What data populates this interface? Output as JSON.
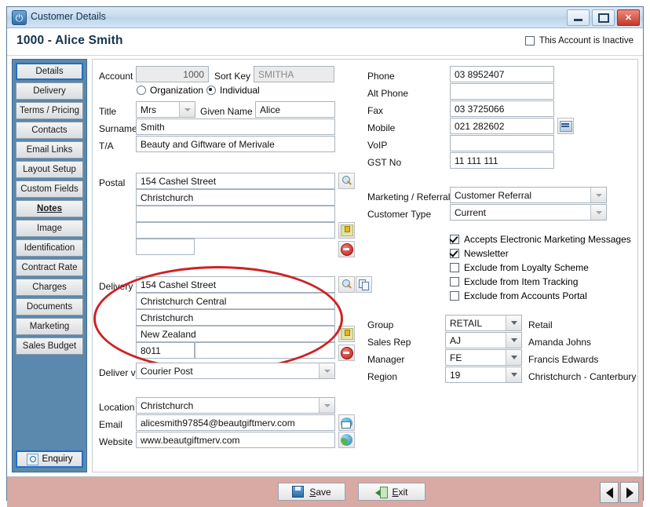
{
  "window": {
    "title": "Customer Details",
    "app_icon": "power-icon",
    "controls": {
      "minimize": "minimize-icon",
      "maximize": "maximize-icon",
      "close": "close-icon"
    }
  },
  "header": {
    "title": "1000 - Alice Smith",
    "inactive_label": "This Account is Inactive",
    "inactive_checked": false
  },
  "sidebar": {
    "items": [
      {
        "label": "Details",
        "selected": true,
        "emphasis": false
      },
      {
        "label": "Delivery",
        "selected": false,
        "emphasis": false
      },
      {
        "label": "Terms / Pricing",
        "selected": false,
        "emphasis": false
      },
      {
        "label": "Contacts",
        "selected": false,
        "emphasis": false
      },
      {
        "label": "Email Links",
        "selected": false,
        "emphasis": false
      },
      {
        "label": "Layout Setup",
        "selected": false,
        "emphasis": false
      },
      {
        "label": "Custom Fields",
        "selected": false,
        "emphasis": false
      },
      {
        "label": "Notes",
        "selected": false,
        "emphasis": true
      },
      {
        "label": "Image",
        "selected": false,
        "emphasis": false
      },
      {
        "label": "Identification",
        "selected": false,
        "emphasis": false
      },
      {
        "label": "Contract Rate",
        "selected": false,
        "emphasis": false
      },
      {
        "label": "Charges",
        "selected": false,
        "emphasis": false
      },
      {
        "label": "Documents",
        "selected": false,
        "emphasis": false
      },
      {
        "label": "Marketing",
        "selected": false,
        "emphasis": false
      },
      {
        "label": "Sales Budget",
        "selected": false,
        "emphasis": false
      }
    ],
    "enquiry_label": "Enquiry",
    "enquiry_icon": "enquiry-icon"
  },
  "form": {
    "account_label": "Account",
    "account_value": "1000",
    "sort_key_label": "Sort Key",
    "sort_key_value": "SMITHA",
    "entity_type": {
      "organization_label": "Organization",
      "individual_label": "Individual",
      "selected": "Individual"
    },
    "title_label": "Title",
    "title_value": "Mrs",
    "given_name_label": "Given Name",
    "given_name_value": "Alice",
    "surname_label": "Surname",
    "surname_value": "Smith",
    "ta_label": "T/A",
    "ta_value": "Beauty and Giftware of Merivale",
    "postal_label": "Postal",
    "postal_lines": [
      "154 Cashel Street",
      "Christchurch",
      "",
      ""
    ],
    "postal_postcode": "",
    "delivery_label": "Delivery",
    "delivery_lines": [
      "154 Cashel Street",
      "Christchurch Central",
      "Christchurch",
      "New Zealand"
    ],
    "delivery_postcode": "8011",
    "deliver_via_label": "Deliver via",
    "deliver_via_value": "Courier Post",
    "location_label": "Location",
    "location_value": "Christchurch",
    "email_label": "Email",
    "email_value": "alicesmith97854@beautgiftmerv.com",
    "website_label": "Website",
    "website_value": "www.beautgiftmerv.com"
  },
  "contact": {
    "rows": [
      {
        "label": "Phone",
        "value": "03 8952407"
      },
      {
        "label": "Alt Phone",
        "value": ""
      },
      {
        "label": "Fax",
        "value": "03 3725066"
      },
      {
        "label": "Mobile",
        "value": "021 282602"
      },
      {
        "label": "VoIP",
        "value": ""
      },
      {
        "label": "GST No",
        "value": "11 111 111"
      }
    ],
    "sms_icon": "sms-icon"
  },
  "classification": {
    "marketing_label": "Marketing / Referral",
    "marketing_value": "Customer Referral",
    "customer_type_label": "Customer Type",
    "customer_type_value": "Current"
  },
  "checkboxes": [
    {
      "label": "Accepts Electronic Marketing Messages",
      "checked": true
    },
    {
      "label": "Newsletter",
      "checked": true
    },
    {
      "label": "Exclude from Loyalty Scheme",
      "checked": false
    },
    {
      "label": "Exclude from Item Tracking",
      "checked": false
    },
    {
      "label": "Exclude from Accounts Portal",
      "checked": false
    }
  ],
  "assignments": [
    {
      "label": "Group",
      "code": "RETAIL",
      "description": "Retail"
    },
    {
      "label": "Sales Rep",
      "code": "AJ",
      "description": "Amanda Johns"
    },
    {
      "label": "Manager",
      "code": "FE",
      "description": "Francis Edwards"
    },
    {
      "label": "Region",
      "code": "19",
      "description": "Christchurch - Canterbury"
    }
  ],
  "icons": {
    "postal_search": "magnifier-icon",
    "postal_map": "map-pin-icon",
    "postal_block": "no-entry-icon",
    "delivery_search": "magnifier-icon",
    "delivery_copy": "copy-icon",
    "delivery_map": "map-pin-icon",
    "delivery_block": "no-entry-icon",
    "email_send": "mail-icon",
    "website_open": "globe-icon"
  },
  "footer": {
    "save_label": "Save",
    "save_icon": "save-icon",
    "exit_label": "Exit",
    "exit_icon": "exit-icon",
    "prev_icon": "arrow-left-icon",
    "next_icon": "arrow-right-icon"
  },
  "colors": {
    "accent": "#5b88ad",
    "footer": "#d9a9a4",
    "highlight": "#cf2222",
    "close": "#c0392b"
  }
}
